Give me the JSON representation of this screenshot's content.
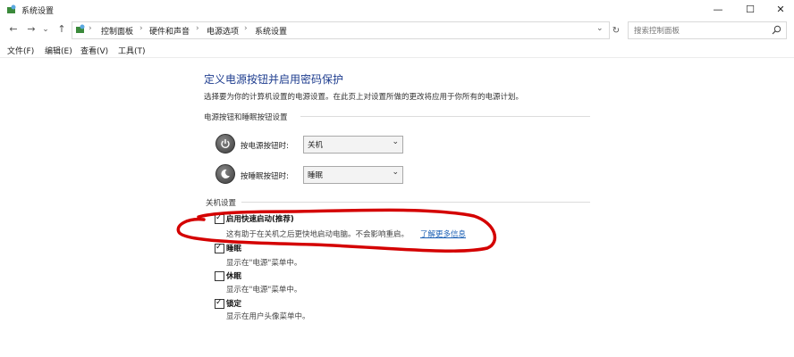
{
  "window": {
    "title": "系统设置",
    "minimize_glyph": "—",
    "maximize_glyph": "☐",
    "close_glyph": "✕"
  },
  "nav": {
    "back": "←",
    "forward": "→",
    "recent": "⌄",
    "up": "↑"
  },
  "breadcrumb": {
    "items": [
      "控制面板",
      "硬件和声音",
      "电源选项",
      "系统设置"
    ],
    "dropdown": "⌄",
    "refresh": "↻"
  },
  "search": {
    "placeholder": "搜索控制面板",
    "icon": "search-icon"
  },
  "menu": [
    "文件(F)",
    "编辑(E)",
    "查看(V)",
    "工具(T)"
  ],
  "page": {
    "title": "定义电源按钮并启用密码保护",
    "description": "选择要为你的计算机设置的电源设置。在此页上对设置所做的更改将应用于你所有的电源计划。"
  },
  "power_section": {
    "label": "电源按钮和睡眠按钮设置",
    "rows": [
      {
        "label": "按电源按钮时:",
        "value": "关机",
        "icon": "power-icon"
      },
      {
        "label": "按睡眠按钮时:",
        "value": "睡眠",
        "icon": "sleep-icon"
      }
    ]
  },
  "shutdown_section": {
    "label": "关机设置",
    "options": [
      {
        "title": "启用快速启动(推荐)",
        "checked": true,
        "desc": "这有助于在关机之后更快地启动电脑。不会影响重启。",
        "link": "了解更多信息"
      },
      {
        "title": "睡眠",
        "checked": true,
        "desc": "显示在\"电源\"菜单中。"
      },
      {
        "title": "休眠",
        "checked": false,
        "desc": "显示在\"电源\"菜单中。"
      },
      {
        "title": "锁定",
        "checked": true,
        "desc": "显示在用户头像菜单中。"
      }
    ]
  },
  "colors": {
    "heading": "#1e3d8f",
    "link": "#1a5fb4",
    "annotation": "#d40000"
  }
}
